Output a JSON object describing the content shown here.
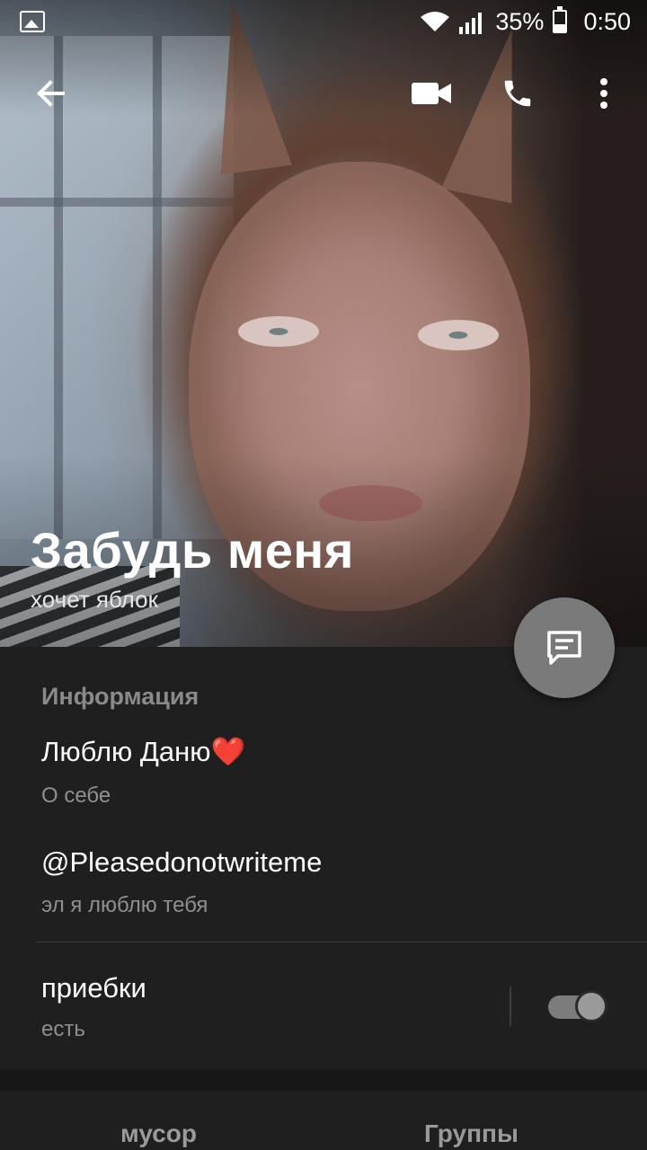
{
  "status_bar": {
    "battery_percent_label": "35%",
    "battery_level": 0.35,
    "time": "0:50",
    "icons": [
      "gallery-icon",
      "wifi-icon",
      "signal-icon",
      "battery-icon"
    ]
  },
  "toolbar": {
    "back_icon": "arrow-left-icon",
    "video_icon": "video-call-icon",
    "call_icon": "phone-icon",
    "more_icon": "more-vertical-icon"
  },
  "profile": {
    "name": "Забудь меня",
    "status": "хочет яблок"
  },
  "fab": {
    "icon": "message-icon"
  },
  "info": {
    "section_title": "Информация",
    "rows": [
      {
        "title": "Люблю Даню❤️",
        "subtitle": "О себе"
      },
      {
        "title": "@Pleasedonotwriteme",
        "subtitle": "эл я люблю тебя"
      },
      {
        "title": "приебки",
        "subtitle": "есть",
        "toggle_on": true
      }
    ]
  },
  "tabs": [
    "мусор",
    "Группы"
  ],
  "colors": {
    "background": "#1f1f1f",
    "fab": "#7a7a7a",
    "muted_text": "#8f8f8f"
  }
}
